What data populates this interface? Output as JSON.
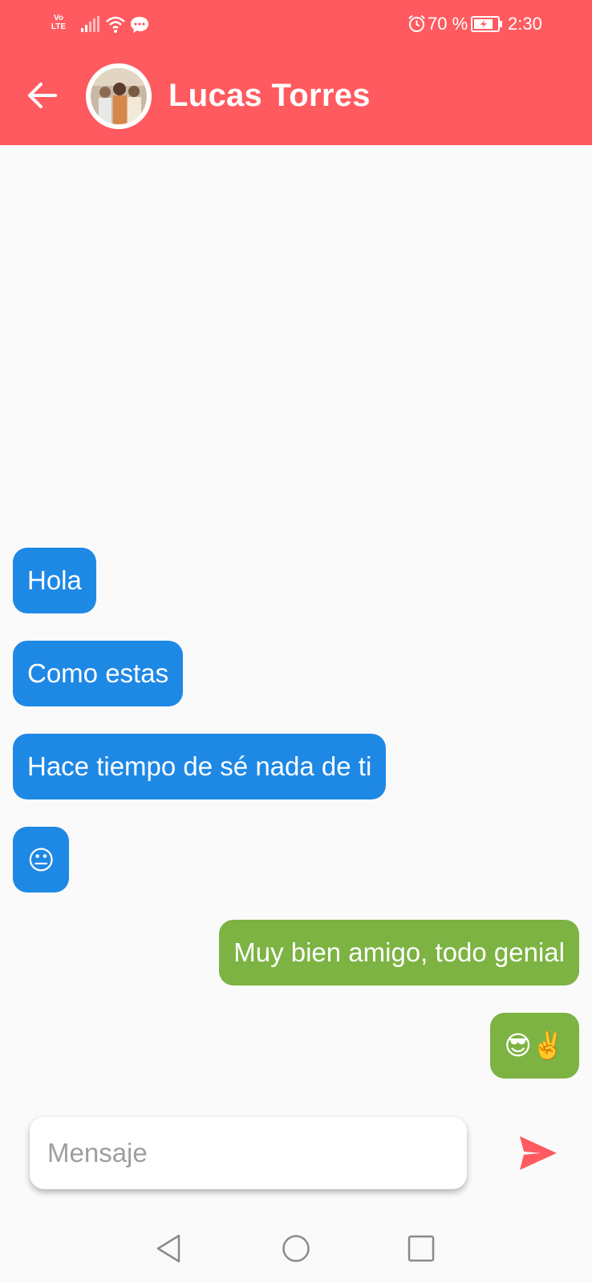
{
  "status_bar": {
    "volte_line1": "Vo",
    "volte_line2": "LTE",
    "battery_percent": "70 %",
    "time": "2:30",
    "icons": [
      "signal-icon",
      "wifi-icon",
      "chat-notification-icon",
      "alarm-icon",
      "battery-charging-icon"
    ]
  },
  "header": {
    "contact_name": "Lucas Torres",
    "background_color": "#ff5a5f",
    "icons": [
      "back-arrow-icon",
      "contact-avatar"
    ]
  },
  "messages": [
    {
      "direction": "in",
      "text": "Hola"
    },
    {
      "direction": "in",
      "text": "Como estas"
    },
    {
      "direction": "in",
      "text": "Hace tiempo de sé nada de ti"
    },
    {
      "direction": "in",
      "text": "😐"
    },
    {
      "direction": "out",
      "text": "Muy bien amigo, todo genial"
    },
    {
      "direction": "out",
      "text": "😎✌️"
    }
  ],
  "colors": {
    "incoming_bubble": "#1e88e5",
    "outgoing_bubble": "#7cb342",
    "accent": "#ff5a5f"
  },
  "composer": {
    "placeholder": "Mensaje",
    "value": "",
    "send_icon": "send-icon"
  },
  "nav_bar": {
    "icons": [
      "nav-back-icon",
      "nav-home-icon",
      "nav-recents-icon"
    ]
  }
}
